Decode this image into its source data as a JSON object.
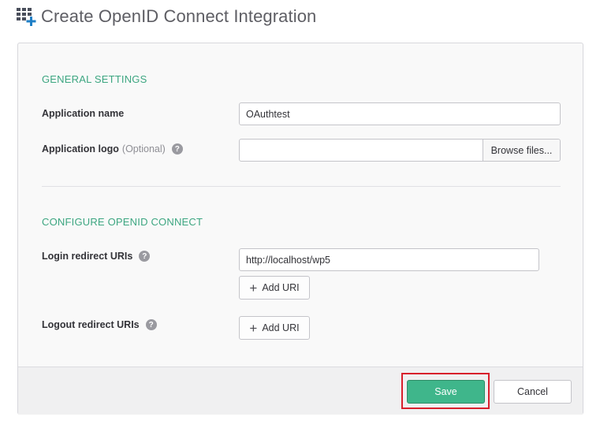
{
  "header": {
    "title": "Create OpenID Connect Integration",
    "icon": "grid-plus-icon"
  },
  "general_settings": {
    "heading": "GENERAL SETTINGS",
    "app_name_label": "Application name",
    "app_name_value": "OAuthtest",
    "app_logo_label": "Application logo",
    "app_logo_optional": "(Optional)",
    "browse_label": "Browse files..."
  },
  "openid": {
    "heading": "CONFIGURE OPENID CONNECT",
    "login_label": "Login redirect URIs",
    "login_uri_value": "http://localhost/wp5",
    "logout_label": "Logout redirect URIs",
    "add_uri_label": "Add URI"
  },
  "footer": {
    "save_label": "Save",
    "cancel_label": "Cancel"
  },
  "colors": {
    "accent": "#3fb68b",
    "section_heading": "#3da681",
    "highlight": "#d8202c"
  }
}
